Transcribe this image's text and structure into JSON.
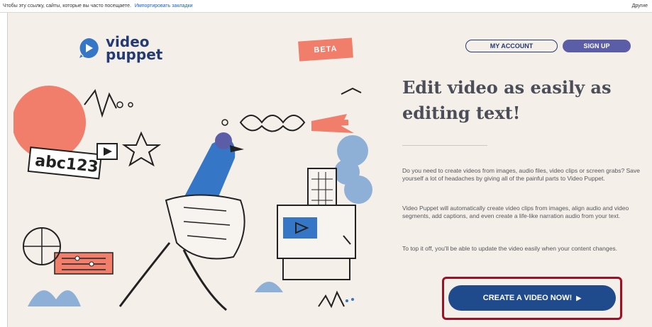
{
  "topbar": {
    "message": "Чтобы эту ссылку, сайты, которые вы часто посещаете.",
    "link": "Импортировать закладки",
    "right": "Другие"
  },
  "logo": {
    "text_line1": "video",
    "text_line2": "puppet"
  },
  "beta": "BETA",
  "nav": {
    "account": "MY ACCOUNT",
    "signup": "SIGN UP"
  },
  "headline": "Edit video as easily as editing text!",
  "paragraphs": [
    "Do you need to create videos from images, audio files, video clips or screen grabs? Save yourself a lot of headaches by giving all of the painful parts to Video Puppet.",
    "Video Puppet will automatically create video clips from images, align audio and video segments, add captions, and even create a life-like narration audio from your text.",
    "To top it off, you'll be able to update the video easily when your content changes."
  ],
  "illustration": {
    "label": "abc123"
  },
  "cta": {
    "label": "CREATE A VIDEO NOW!",
    "arrow": "▶"
  },
  "colors": {
    "background": "#f4efe8",
    "navy": "#243a73",
    "coral": "#f07e6b",
    "blue": "#3576c6",
    "cta": "#1f4a8c",
    "highlight": "#a30f22"
  }
}
